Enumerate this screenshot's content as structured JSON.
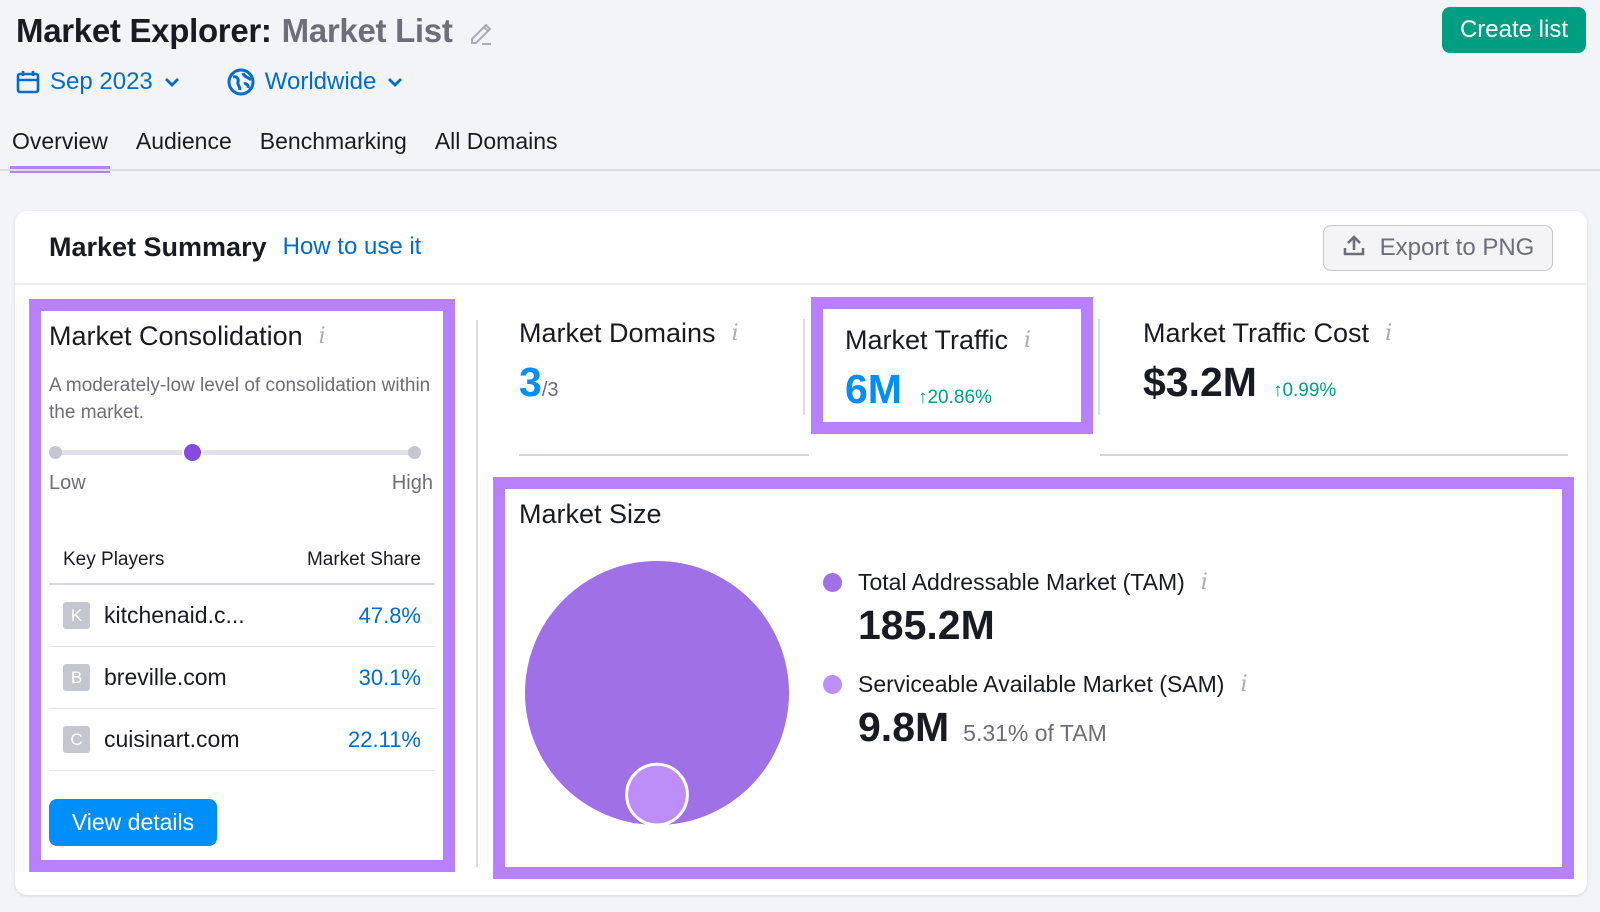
{
  "header": {
    "title_main": "Market Explorer:",
    "title_sub": "Market List",
    "create_label": "Create list"
  },
  "filters": {
    "date": "Sep 2023",
    "region": "Worldwide"
  },
  "tabs": [
    {
      "label": "Overview",
      "active": true
    },
    {
      "label": "Audience",
      "active": false
    },
    {
      "label": "Benchmarking",
      "active": false
    },
    {
      "label": "All Domains",
      "active": false
    }
  ],
  "summary": {
    "title": "Market Summary",
    "howto": "How to use it",
    "export_label": "Export to PNG"
  },
  "consolidation": {
    "title": "Market Consolidation",
    "description": "A moderately-low level of consolidation within the market.",
    "level_fraction": 0.38,
    "low_label": "Low",
    "high_label": "High",
    "col_players": "Key Players",
    "col_share": "Market Share",
    "players": [
      {
        "initial": "K",
        "domain": "kitchenaid.c...",
        "share": "47.8%"
      },
      {
        "initial": "B",
        "domain": "breville.com",
        "share": "30.1%"
      },
      {
        "initial": "C",
        "domain": "cuisinart.com",
        "share": "22.11%"
      }
    ],
    "view_details": "View details"
  },
  "metrics": {
    "domains": {
      "title": "Market Domains",
      "value": "3",
      "total": "/3"
    },
    "traffic": {
      "title": "Market Traffic",
      "value": "6M",
      "delta": "↑20.86%"
    },
    "cost": {
      "title": "Market Traffic Cost",
      "value": "$3.2M",
      "delta": "↑0.99%"
    }
  },
  "market_size": {
    "title": "Market Size",
    "tam": {
      "label": "Total Addressable Market (TAM)",
      "value": "185.2M",
      "value_num": 185.2,
      "color": "#a070e6"
    },
    "sam": {
      "label": "Serviceable Available Market (SAM)",
      "value": "9.8M",
      "value_num": 9.8,
      "pct_of_tam": "5.31% of TAM",
      "color": "#bd8ef7"
    }
  },
  "colors": {
    "accent_highlight": "#b880fb",
    "brand_green": "#009f81",
    "link_blue": "#006dca",
    "primary_blue": "#008ff8",
    "knob_purple": "#8649e1"
  }
}
